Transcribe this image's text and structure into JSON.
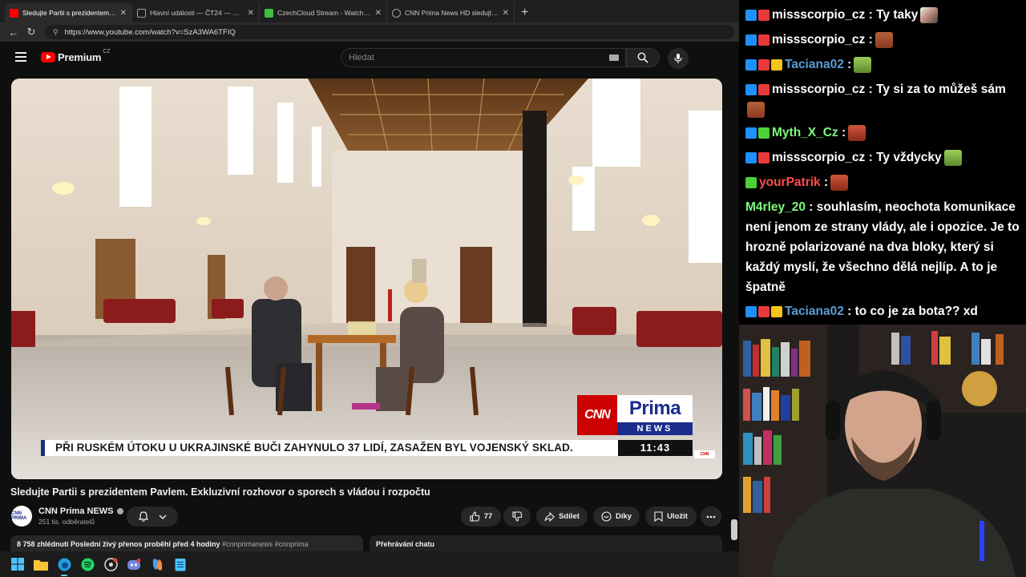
{
  "browser": {
    "tabs": [
      {
        "label": "Sledujte Partii s prezidentem Pavle",
        "favicon_color": "#ff0000",
        "active": true
      },
      {
        "label": "Hlavní události — ČT24 — Česká",
        "favicon_color": "#9aa0a6",
        "active": false
      },
      {
        "label": "CzechCloud Stream - Watch Live",
        "favicon_color": "#3fbf3f",
        "active": false
      },
      {
        "label": "CNN Prima News HD sledujte onl",
        "favicon_color": "#9aa0a6",
        "active": false
      }
    ],
    "url": "https://www.youtube.com/watch?v=SzA3WA6TFIQ"
  },
  "youtube": {
    "logo_text": "Premium",
    "logo_region": "CZ",
    "search_placeholder": "Hledat"
  },
  "video": {
    "ticker_text": "PŘI RUSKÉM ÚTOKU U UKRAJINSKÉ BUČI ZAHYNULO 37 LIDÍ, ZASAŽEN BYL VOJENSKÝ SKLAD.",
    "clock": "11:43",
    "logo_cnn": "CNN",
    "logo_prima": "Prima",
    "logo_news": "NEWS",
    "title": "Sledujte Partii s prezidentem Pavlem. Exkluzivní rozhovor o sporech s vládou i rozpočtu"
  },
  "channel": {
    "name": "CNN Prima NEWS",
    "avatar_text": "CNN PRIMA",
    "subscribers": "251 tis. odběratelů"
  },
  "actions": {
    "likes": "77",
    "share": "Sdílet",
    "thanks": "Díky",
    "save": "Uložit"
  },
  "description": {
    "stats": "8 758 zhlédnutí  Poslední živý přenos proběhl před 4 hodiny",
    "tags": "#cnnprimanews #cnnprima"
  },
  "chat_replay_label": "Přehrávání chatu",
  "chat": [
    {
      "user": "missscorpio_cz",
      "user_color": "#ffffff",
      "text": ": Ty taky",
      "badges": [
        "#1e90ff",
        "#e83a3a"
      ]
    },
    {
      "user": "missscorpio_cz",
      "user_color": "#ffffff",
      "text": ":",
      "badges": [
        "#1e90ff",
        "#e83a3a"
      ]
    },
    {
      "user": "Taciana02",
      "user_color": "#5b9bd5",
      "text": ":",
      "badges": [
        "#1e90ff",
        "#e83a3a",
        "#f5c518"
      ]
    },
    {
      "user": "missscorpio_cz",
      "user_color": "#ffffff",
      "text": ": Ty si za to můžeš sám",
      "badges": [
        "#1e90ff",
        "#e83a3a"
      ]
    },
    {
      "user": "Myth_X_Cz",
      "user_color": "#7cfc7c",
      "text": ":",
      "badges": [
        "#1e90ff",
        "#4cd137"
      ]
    },
    {
      "user": "missscorpio_cz",
      "user_color": "#ffffff",
      "text": ": Ty vždycky",
      "badges": [
        "#1e90ff",
        "#e83a3a"
      ]
    },
    {
      "user": "yourPatrik",
      "user_color": "#ff4b4b",
      "text": ":",
      "badges": [
        "#4cd137"
      ]
    },
    {
      "user": "M4rley_20",
      "user_color": "#7cfc7c",
      "text": ": souhlasím, neochota komunikace není jenom ze strany vlády, ale i opozice. Je to hrozně polarizované na dva bloky, který si každý myslí, že všechno dělá nejlíp. A to je špatně",
      "badges": []
    },
    {
      "user": "Taciana02",
      "user_color": "#5b9bd5",
      "text": ": to co je za bota?? xd",
      "badges": [
        "#1e90ff",
        "#e83a3a",
        "#f5c518"
      ]
    }
  ]
}
